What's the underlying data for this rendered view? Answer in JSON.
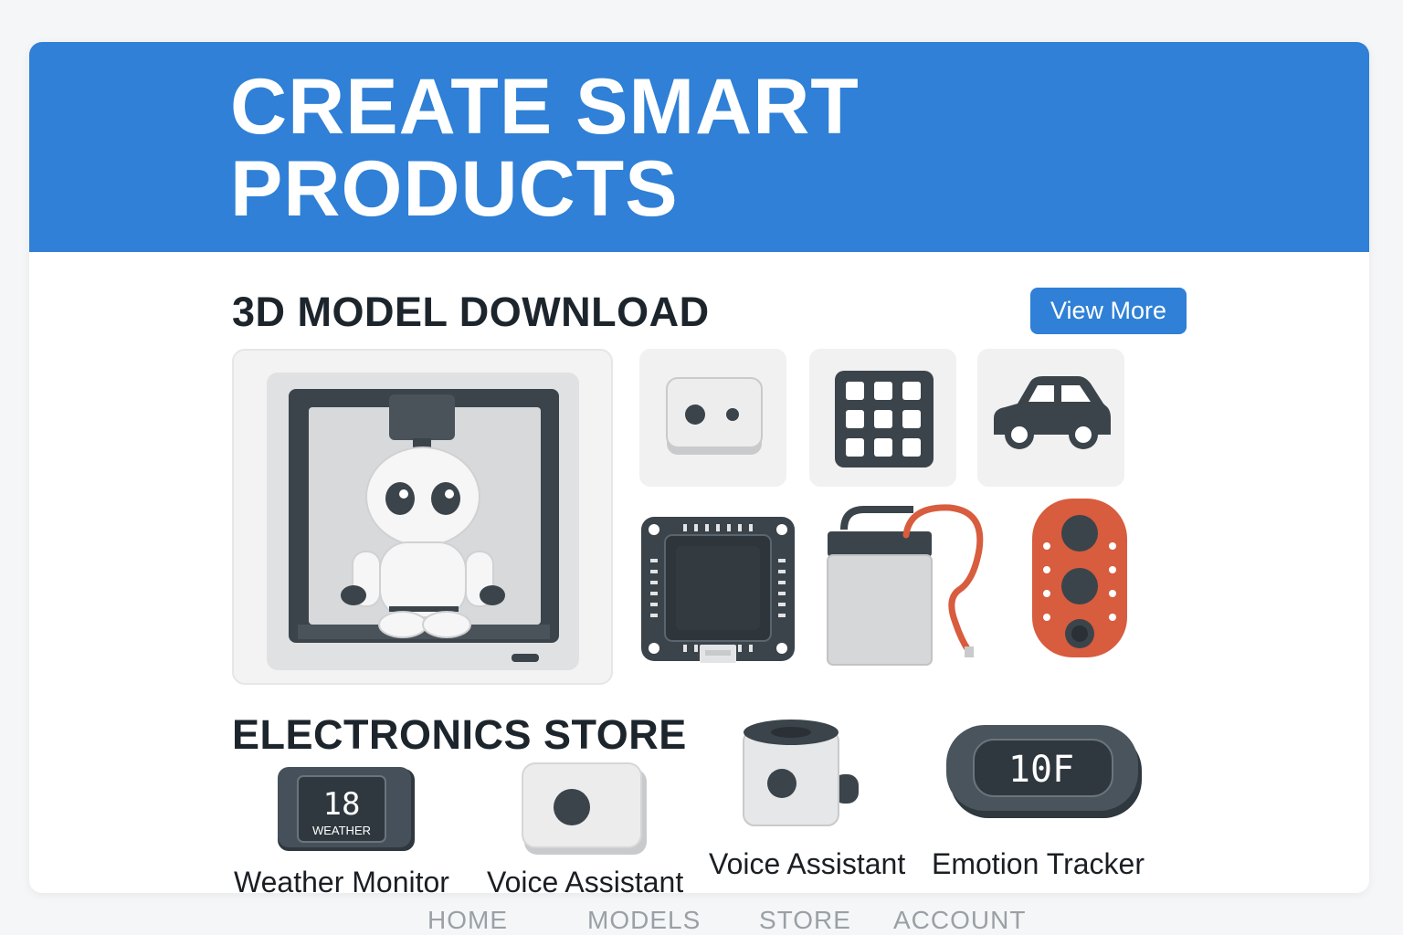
{
  "hero": {
    "title_line1": "CREATE SMART",
    "title_line2": "PRODUCTS"
  },
  "models_section": {
    "title": "3D MODEL DOWNLOAD",
    "view_more_label": "View More",
    "items": [
      {
        "icon": "3d-printer-robot-icon"
      },
      {
        "icon": "sensor-module-icon"
      },
      {
        "icon": "keypad-icon"
      },
      {
        "icon": "car-icon"
      },
      {
        "icon": "microcontroller-board-icon"
      },
      {
        "icon": "battery-pack-icon"
      },
      {
        "icon": "speaker-module-icon"
      }
    ]
  },
  "store_section": {
    "title": "ELECTRONICS STORE",
    "products": [
      {
        "label": "Weather Monitor",
        "display": "18",
        "sublabel": "WEATHER",
        "icon": "weather-monitor-icon"
      },
      {
        "label": "Voice Assistant",
        "icon": "voice-assistant-button-icon"
      },
      {
        "label": "Voice Assistant",
        "icon": "voice-assistant-cylinder-icon"
      },
      {
        "label": "Emotion Tracker",
        "display": "10F",
        "icon": "emotion-tracker-icon"
      }
    ]
  },
  "nav": {
    "items": [
      "HOME",
      "MODELS",
      "STORE",
      "ACCOUNT"
    ]
  },
  "colors": {
    "primary": "#2f80d6",
    "dark": "#3b444b",
    "accent": "#d85c3e",
    "light": "#e3e4e6"
  }
}
